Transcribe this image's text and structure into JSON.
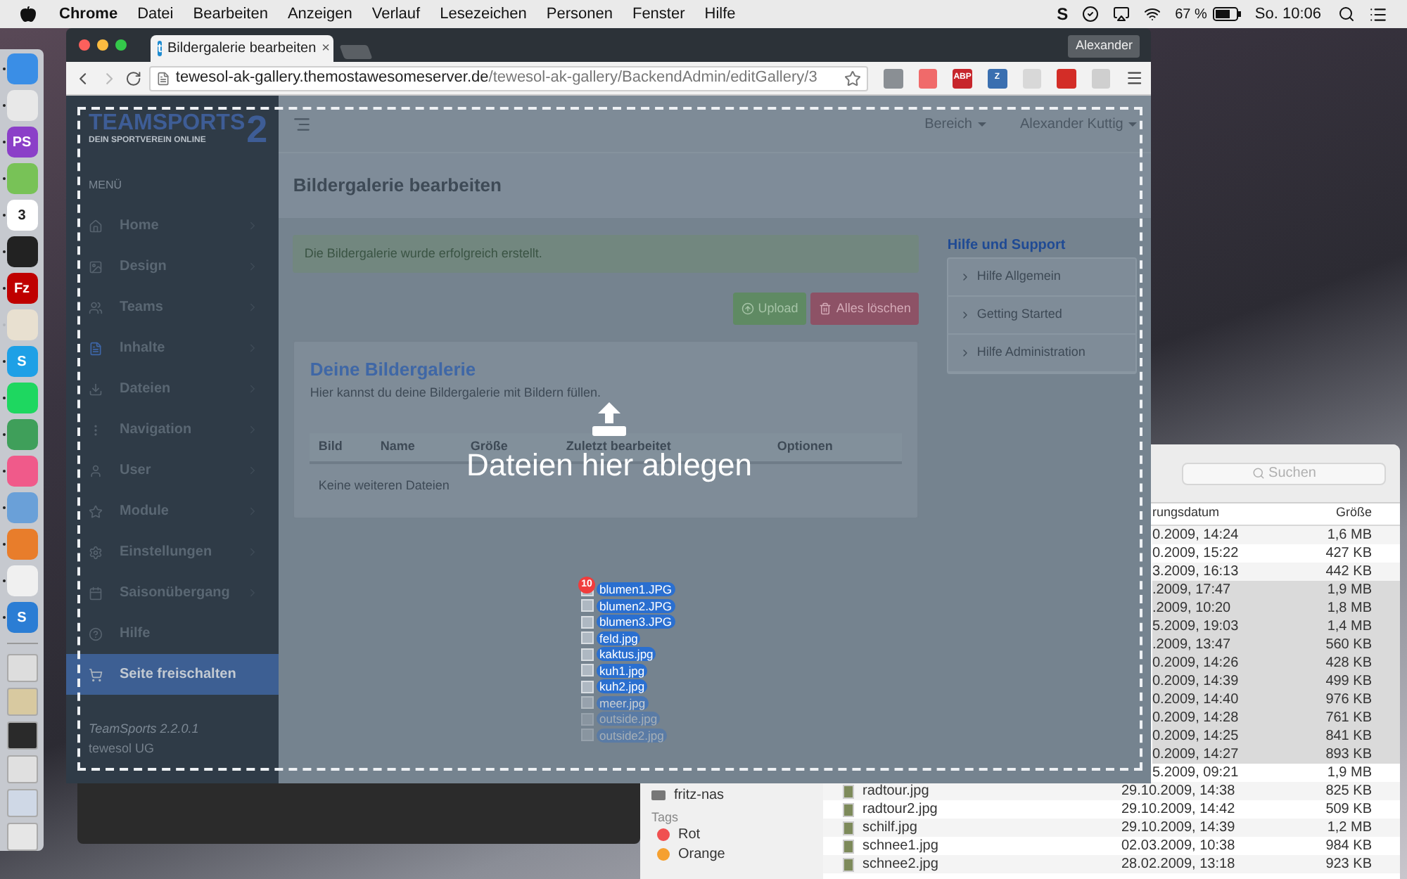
{
  "menu_bar": {
    "app": "Chrome",
    "menus": [
      "Datei",
      "Bearbeiten",
      "Anzeigen",
      "Verlauf",
      "Lesezeichen",
      "Personen",
      "Fenster",
      "Hilfe"
    ],
    "status_glyph": "S",
    "battery": "67 %",
    "clock": "So. 10:06"
  },
  "dock": {
    "apps": [
      {
        "color": "#3a8ee6",
        "running": true
      },
      {
        "color": "#e8e8e8",
        "running": true
      },
      {
        "color": "#8b3fc8",
        "running": true,
        "glyph": "PS"
      },
      {
        "color": "#78c257",
        "running": true
      },
      {
        "color": "#ffffff",
        "running": true,
        "glyph": "3"
      },
      {
        "color": "#222222",
        "running": true
      },
      {
        "color": "#bf0000",
        "running": true,
        "glyph": "Fz"
      },
      {
        "color": "#e8e0d0",
        "running": false
      },
      {
        "color": "#1ea0e6",
        "running": true,
        "glyph": "S"
      },
      {
        "color": "#1ed760",
        "running": true
      },
      {
        "color": "#3f9f5a",
        "running": true
      },
      {
        "color": "#f05a8a",
        "running": true
      },
      {
        "color": "#6aa0d8",
        "running": true
      },
      {
        "color": "#e87d2b",
        "running": true
      },
      {
        "color": "#f0f0f0",
        "running": true
      },
      {
        "color": "#2b7dd4",
        "running": true,
        "glyph": "S"
      }
    ],
    "stacks": [
      {
        "color": "#dddddd"
      },
      {
        "color": "#d8c9a0"
      },
      {
        "color": "#2a2a2a"
      },
      {
        "color": "#e0e0e0"
      },
      {
        "color": "#cfd8e6"
      },
      {
        "color": "#e6e6e6"
      }
    ]
  },
  "browser": {
    "tab": {
      "favicon": "t",
      "title": "Bildergalerie bearbeiten",
      "close": "×"
    },
    "profile": "Alexander",
    "url": {
      "host": "tewesol-ak-gallery.themostawesomeserver.de",
      "path": "/tewesol-ak-gallery/BackendAdmin/editGallery/3"
    },
    "extensions": [
      {
        "color": "#8a8f94"
      },
      {
        "color": "#f06a6a"
      },
      {
        "color": "#c7262c",
        "label": "ABP"
      },
      {
        "color": "#3a6fb0",
        "label": "Z"
      },
      {
        "color": "#d8d8d8"
      },
      {
        "color": "#d32d27"
      },
      {
        "color": "#cfcfcf"
      }
    ]
  },
  "app_sidebar": {
    "logo": {
      "name": "TEAMSPORTS",
      "number": "2",
      "tagline": "DEIN SPORTVEREIN ONLINE"
    },
    "heading": "MENÜ",
    "items": [
      {
        "label": "Home",
        "current": false,
        "highlighted": false,
        "submenu": true
      },
      {
        "label": "Design",
        "current": false,
        "highlighted": false,
        "submenu": true
      },
      {
        "label": "Teams",
        "current": false,
        "highlighted": false,
        "submenu": true
      },
      {
        "label": "Inhalte",
        "current": true,
        "highlighted": false,
        "submenu": true
      },
      {
        "label": "Dateien",
        "current": false,
        "highlighted": false,
        "submenu": true
      },
      {
        "label": "Navigation",
        "current": false,
        "highlighted": false,
        "submenu": true
      },
      {
        "label": "User",
        "current": false,
        "highlighted": false,
        "submenu": true
      },
      {
        "label": "Module",
        "current": false,
        "highlighted": false,
        "submenu": true
      },
      {
        "label": "Einstellungen",
        "current": false,
        "highlighted": false,
        "submenu": true
      },
      {
        "label": "Saisonübergang",
        "current": false,
        "highlighted": false,
        "submenu": true
      },
      {
        "label": "Hilfe",
        "current": false,
        "highlighted": false,
        "submenu": false
      },
      {
        "label": "Seite freischalten",
        "current": false,
        "highlighted": true,
        "submenu": false
      }
    ],
    "version": "TeamSports 2.2.0.1",
    "company": "tewesol UG"
  },
  "topbar": {
    "menus": [
      "Bereich",
      "Alexander Kuttig"
    ]
  },
  "page": {
    "title": "Bildergalerie bearbeiten",
    "alert": "Die Bildergalerie wurde erfolgreich erstellt.",
    "buttons": [
      {
        "label": "Upload",
        "kind": "success"
      },
      {
        "label": "Alles löschen",
        "kind": "danger"
      }
    ],
    "gallery": {
      "title": "Deine Bildergalerie",
      "subtitle": "Hier kannst du deine Bildergalerie mit Bildern füllen.",
      "columns": [
        "Bild",
        "Name",
        "Größe",
        "Zuletzt bearbeitet",
        "Optionen"
      ],
      "empty": "Keine weiteren Dateien"
    },
    "help": {
      "title": "Hilfe und Support",
      "items": [
        "Hilfe Allgemein",
        "Getting Started",
        "Hilfe Administration"
      ]
    }
  },
  "drop_zone": {
    "message": "Dateien hier ablegen"
  },
  "drag": {
    "count": "10",
    "files": [
      "blumen1.JPG",
      "blumen2.JPG",
      "blumen3.JPG",
      "feld.jpg",
      "kaktus.jpg",
      "kuh1.jpg",
      "kuh2.jpg",
      "meer.jpg",
      "outside.jpg",
      "outside2.jpg"
    ]
  },
  "finder": {
    "search": {
      "placeholder": "Suchen"
    },
    "columns": [
      "rungsdatum",
      "Größe"
    ],
    "sidebar": [
      {
        "kind": "device",
        "label": "fritz-nas"
      },
      {
        "kind": "heading",
        "label": "Tags"
      },
      {
        "kind": "tag",
        "label": "Rot",
        "color": "#f05050"
      },
      {
        "kind": "tag",
        "label": "Orange",
        "color": "#f5a030"
      }
    ],
    "rows": [
      {
        "date": "0.2009, 14:24",
        "size": "1,6 MB",
        "selected": false
      },
      {
        "date": "0.2009, 15:22",
        "size": "427 KB",
        "selected": false
      },
      {
        "date": "3.2009, 16:13",
        "size": "442 KB",
        "selected": false
      },
      {
        "date": ".2009, 17:47",
        "size": "1,9 MB",
        "selected": true
      },
      {
        "date": ".2009, 10:20",
        "size": "1,8 MB",
        "selected": true
      },
      {
        "date": "5.2009, 19:03",
        "size": "1,4 MB",
        "selected": true
      },
      {
        "date": ".2009, 13:47",
        "size": "560 KB",
        "selected": true
      },
      {
        "date": "0.2009, 14:26",
        "size": "428 KB",
        "selected": true
      },
      {
        "date": "0.2009, 14:39",
        "size": "499 KB",
        "selected": true
      },
      {
        "date": "0.2009, 14:40",
        "size": "976 KB",
        "selected": true
      },
      {
        "date": "0.2009, 14:28",
        "size": "761 KB",
        "selected": true
      },
      {
        "date": "0.2009, 14:25",
        "size": "841 KB",
        "selected": true
      },
      {
        "date": "0.2009, 14:27",
        "size": "893 KB",
        "selected": true
      },
      {
        "date": "5.2009, 09:21",
        "size": "1,9 MB",
        "selected": false
      },
      {
        "name": "radtour.jpg",
        "date": "29.10.2009, 14:38",
        "size": "825 KB",
        "selected": false
      },
      {
        "name": "radtour2.jpg",
        "date": "29.10.2009, 14:42",
        "size": "509 KB",
        "selected": false
      },
      {
        "name": "schilf.jpg",
        "date": "29.10.2009, 14:39",
        "size": "1,2 MB",
        "selected": false
      },
      {
        "name": "schnee1.jpg",
        "date": "02.03.2009, 10:38",
        "size": "984 KB",
        "selected": false
      },
      {
        "name": "schnee2.jpg",
        "date": "28.02.2009, 13:18",
        "size": "923 KB",
        "selected": false
      }
    ]
  }
}
